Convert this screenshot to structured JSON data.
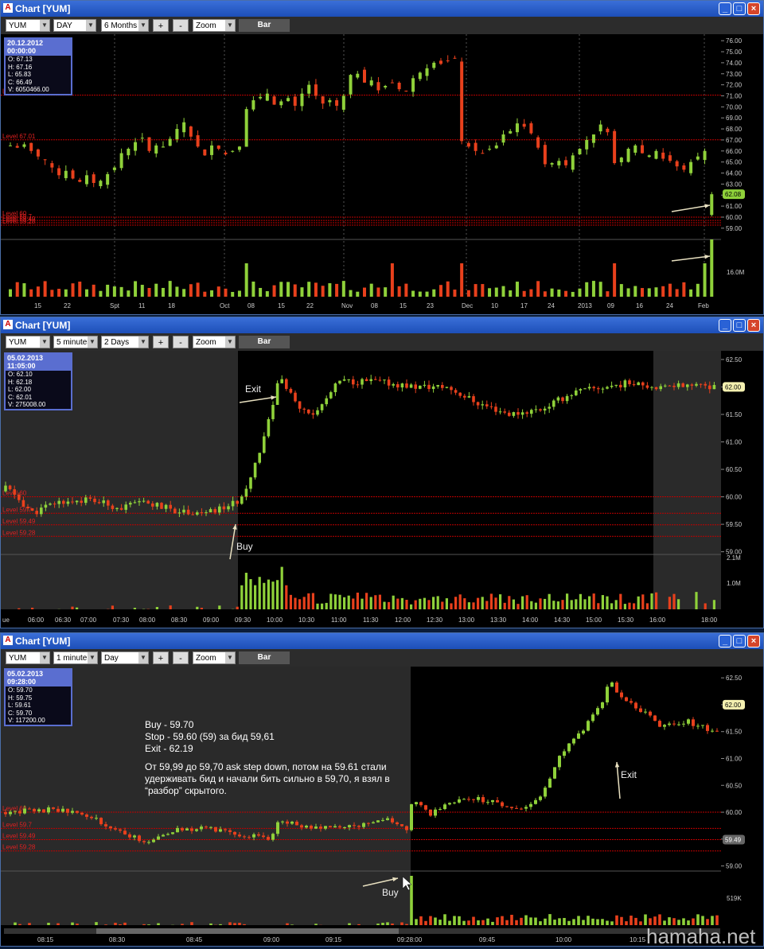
{
  "windows": [
    {
      "title": "Chart [YUM]",
      "symbol": "YUM",
      "interval": "DAY",
      "range": "6 Months",
      "zoom": "Zoom",
      "style": "Bar",
      "plus": "+",
      "minus": "-",
      "info": {
        "date": "20.12.2012 00:00:00",
        "o": "O: 67.13",
        "h": "H: 67.16",
        "l": "L: 65.83",
        "c": "C: 66.49",
        "v": "V: 6050466.00"
      }
    },
    {
      "title": "Chart [YUM]",
      "symbol": "YUM",
      "interval": "5 minutes",
      "range": "2 Days",
      "zoom": "Zoom",
      "style": "Bar",
      "plus": "+",
      "minus": "-",
      "info": {
        "date": "05.02.2013 11:05:00",
        "o": "O: 62.10",
        "h": "H: 62.18",
        "l": "L: 62.00",
        "c": "C: 62.01",
        "v": "V: 275008.00"
      }
    },
    {
      "title": "Chart [YUM]",
      "symbol": "YUM",
      "interval": "1 minute",
      "range": "Day",
      "zoom": "Zoom",
      "style": "Bar",
      "plus": "+",
      "minus": "-",
      "info": {
        "date": "05.02.2013 09:28:00",
        "o": "O: 59.70",
        "h": "H: 59.75",
        "l": "L: 59.61",
        "c": "C: 59.70",
        "v": "V: 117200.00"
      }
    }
  ],
  "note": {
    "lines": [
      "Buy - 59.70",
      "Stop - 59.60 (59) за бид 59,61",
      "Exit - 62.19",
      "",
      "От  59,99 до 59,70 ask step down, потом на 59.61 стали удерживать бид и начали бить сильно в 59,70, я взял в “разбор” скрытого."
    ]
  },
  "watermark": "hamaha.net",
  "colors": {
    "up": "#8fd13a",
    "down": "#e8401c",
    "level": "#c00000",
    "window_title": "#2a5fd0"
  },
  "chart_data": [
    {
      "type": "candlestick",
      "title": "",
      "interval": "DAY",
      "xlabels": [
        "15",
        "22",
        "Spt",
        "11",
        "18",
        "Oct",
        "08",
        "15",
        "22",
        "Nov",
        "08",
        "15",
        "23",
        "Dec",
        "10",
        "17",
        "24",
        "2013",
        "09",
        "16",
        "24",
        "Feb"
      ],
      "ylabels": [
        "76.00",
        "75.00",
        "74.00",
        "73.00",
        "72.00",
        "71.00",
        "70.00",
        "69.00",
        "68.00",
        "67.00",
        "66.00",
        "65.00",
        "64.00",
        "63.00",
        "62.00",
        "61.00",
        "60.00",
        "59.00"
      ],
      "ylim": [
        58.7,
        76.3
      ],
      "last_price": "62.08",
      "levels": [
        {
          "label": "Level 67.01",
          "value": 67.01
        },
        {
          "label": "Level 71.06",
          "value": 71.06
        },
        {
          "label": "Level 60",
          "value": 60.0
        },
        {
          "label": "Level 59.7",
          "value": 59.7
        },
        {
          "label": "Level 59.49",
          "value": 59.49
        },
        {
          "label": "Level 59.28",
          "value": 59.28
        }
      ],
      "volume_label": "16.0M",
      "closes": [
        66.5,
        66.3,
        66.6,
        66.0,
        65.5,
        65.2,
        64.5,
        63.8,
        64.2,
        63.5,
        63.2,
        63.8,
        63.1,
        63.3,
        63.9,
        64.5,
        65.8,
        66.2,
        66.8,
        67.2,
        66.0,
        66.5,
        66.4,
        67.1,
        68.0,
        68.6,
        67.3,
        66.4,
        65.6,
        66.5,
        66.2,
        65.7,
        66.0,
        66.4,
        69.8,
        70.6,
        70.9,
        71.2,
        70.2,
        70.5,
        70.8,
        70.1,
        71.2,
        72.0,
        71.0,
        70.3,
        70.6,
        70.1,
        71.0,
        72.9,
        73.0,
        72.2,
        72.4,
        71.5,
        71.9,
        72.2,
        71.6,
        71.4,
        72.6,
        73.1,
        73.5,
        74.0,
        73.9,
        74.2,
        74.4,
        66.9,
        66.4,
        66.0,
        65.8,
        66.2,
        66.5,
        67.5,
        67.8,
        68.5,
        68.2,
        67.6,
        66.3,
        64.8,
        64.9,
        65.1,
        64.7,
        65.6,
        66.2,
        67.0,
        67.5,
        68.4,
        67.7,
        64.9,
        65.4,
        66.2,
        66.5,
        65.8,
        65.6,
        66.0,
        65.3,
        65.1,
        64.6,
        64.3,
        65.0,
        65.5,
        66.0,
        62.08
      ]
    },
    {
      "type": "candlestick",
      "title": "",
      "interval": "5 minutes",
      "xlabels": [
        "ue",
        "06:00",
        "06:30",
        "07:00",
        "07:30",
        "08:00",
        "08:30",
        "09:00",
        "09:30",
        "10:00",
        "10:30",
        "11:00",
        "11:30",
        "12:00",
        "12:30",
        "13:00",
        "13:30",
        "14:00",
        "14:30",
        "15:00",
        "15:30",
        "16:00",
        "18:00"
      ],
      "ylabels": [
        "62.50",
        "62.00",
        "61.50",
        "61.00",
        "60.50",
        "60.00",
        "59.50",
        "59.00"
      ],
      "ylim": [
        58.98,
        62.6
      ],
      "last_price": "62.00",
      "levels": [
        {
          "label": "Level 60",
          "value": 60.0
        },
        {
          "label": "Level 59.7",
          "value": 59.7
        },
        {
          "label": "Level 59.49",
          "value": 59.49
        },
        {
          "label": "Level 59.28",
          "value": 59.28
        }
      ],
      "volume_labels": [
        "2.1M",
        "1.0M"
      ],
      "annotations": [
        {
          "text": "Exit"
        },
        {
          "text": "Buy"
        }
      ]
    },
    {
      "type": "candlestick",
      "title": "",
      "interval": "1 minute",
      "xlabels": [
        "08:15",
        "08:30",
        "08:45",
        "09:00",
        "09:15",
        "09:28:00",
        "09:45",
        "10:00",
        "10:15"
      ],
      "ylabels": [
        "62.50",
        "62.00",
        "61.50",
        "61.00",
        "60.50",
        "60.00",
        "59.50",
        "59.00"
      ],
      "ylim": [
        58.95,
        62.65
      ],
      "last_price": "62.00",
      "tag_price": "59.49",
      "levels": [
        {
          "label": "Level 60",
          "value": 60.0
        },
        {
          "label": "Level 59.7",
          "value": 59.7
        },
        {
          "label": "Level 59.49",
          "value": 59.49
        },
        {
          "label": "Level 59.28",
          "value": 59.28
        }
      ],
      "volume_label": "519K",
      "annotations": [
        {
          "text": "Exit"
        },
        {
          "text": "Buy"
        }
      ]
    }
  ]
}
